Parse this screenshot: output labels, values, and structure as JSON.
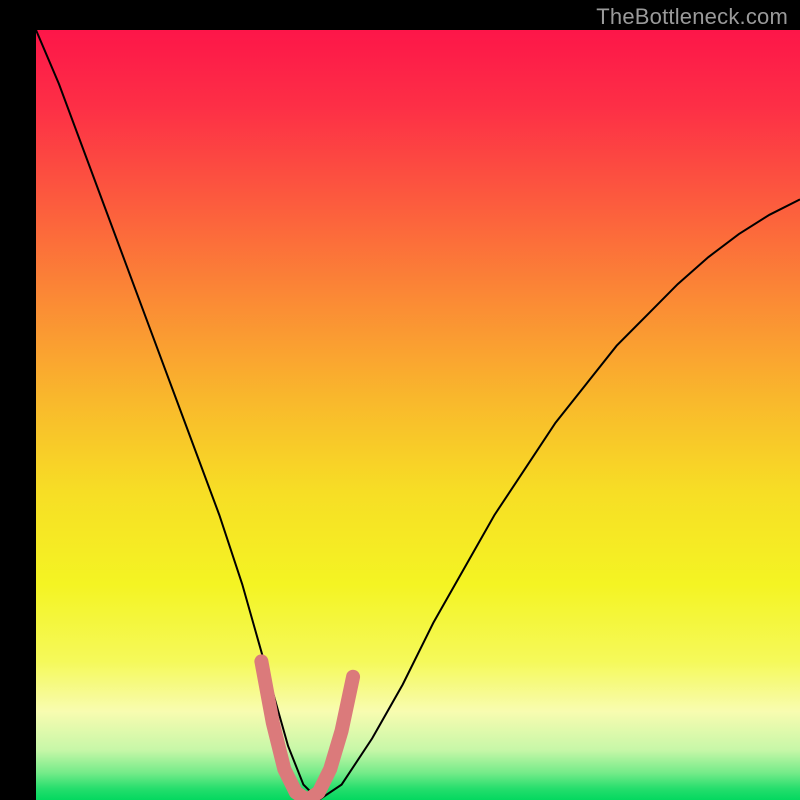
{
  "watermark": "TheBottleneck.com",
  "chart_data": {
    "type": "line",
    "title": "",
    "xlabel": "",
    "ylabel": "",
    "xlim": [
      0,
      100
    ],
    "ylim": [
      0,
      100
    ],
    "grid": false,
    "legend": false,
    "background_gradient": {
      "stops": [
        {
          "offset": 0.0,
          "color": "#fd1649"
        },
        {
          "offset": 0.1,
          "color": "#fd2f46"
        },
        {
          "offset": 0.22,
          "color": "#fc5a3e"
        },
        {
          "offset": 0.35,
          "color": "#fb8a35"
        },
        {
          "offset": 0.48,
          "color": "#f9b82c"
        },
        {
          "offset": 0.6,
          "color": "#f7de25"
        },
        {
          "offset": 0.72,
          "color": "#f4f423"
        },
        {
          "offset": 0.82,
          "color": "#f5f95a"
        },
        {
          "offset": 0.885,
          "color": "#f8fcb0"
        },
        {
          "offset": 0.935,
          "color": "#c7f7a8"
        },
        {
          "offset": 0.965,
          "color": "#74eb89"
        },
        {
          "offset": 0.985,
          "color": "#26de6d"
        },
        {
          "offset": 1.0,
          "color": "#04d85f"
        }
      ]
    },
    "series": [
      {
        "name": "bottleneck-curve",
        "color": "#000000",
        "stroke_width": 2,
        "x": [
          0,
          3,
          6,
          9,
          12,
          15,
          18,
          21,
          24,
          27,
          29,
          31,
          33,
          35,
          37,
          40,
          44,
          48,
          52,
          56,
          60,
          64,
          68,
          72,
          76,
          80,
          84,
          88,
          92,
          96,
          100
        ],
        "y": [
          100,
          93,
          85,
          77,
          69,
          61,
          53,
          45,
          37,
          28,
          21,
          14,
          7,
          2,
          0,
          2,
          8,
          15,
          23,
          30,
          37,
          43,
          49,
          54,
          59,
          63,
          67,
          70.5,
          73.5,
          76,
          78
        ]
      },
      {
        "name": "highlight-band",
        "color": "#db7a7b",
        "stroke_width": 14,
        "linecap": "round",
        "x": [
          29.5,
          31,
          32.5,
          34,
          35.5,
          37,
          38.5,
          40,
          41.5
        ],
        "y": [
          18,
          10,
          4,
          1,
          0,
          1,
          4,
          9,
          16
        ]
      }
    ],
    "annotations": []
  }
}
